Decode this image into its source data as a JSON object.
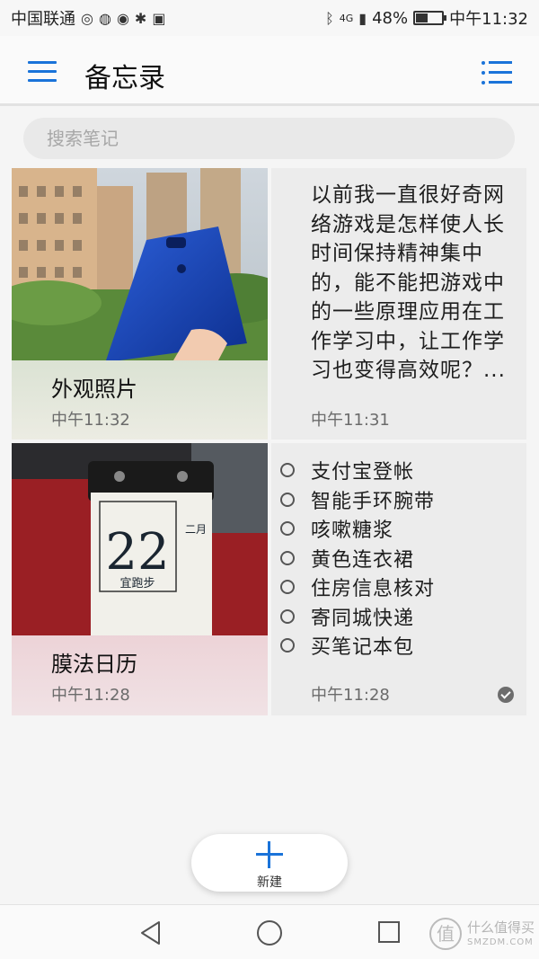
{
  "status_bar": {
    "carrier": "中国联通",
    "battery_percent": "48%",
    "network": "4G",
    "time": "中午11:32",
    "battery_level": 0.48,
    "app_icons": [
      "maps-icon",
      "wechat-icon",
      "weibo-icon",
      "app-icon",
      "shield-icon"
    ]
  },
  "app_bar": {
    "title": "备忘录"
  },
  "search": {
    "placeholder": "搜索笔记"
  },
  "notes": [
    {
      "type": "photo",
      "title": "外观照片",
      "time": "中午11:32"
    },
    {
      "type": "text",
      "text": "以前我一直很好奇网络游戏是怎样使人长时间保持精神集中的，能不能把游戏中的一些原理应用在工作学习中，让工作学习也变得高效呢？...",
      "time": "中午11:31"
    },
    {
      "type": "photo",
      "title": "膜法日历",
      "time": "中午11:28",
      "calendar": {
        "day": "22",
        "month": "二月",
        "note": "宜跑步"
      }
    },
    {
      "type": "checklist",
      "items": [
        "支付宝登帐",
        "智能手环腕带",
        "咳嗽糖浆",
        "黄色连衣裙",
        "住房信息核对",
        "寄同城快递",
        "买笔记本包"
      ],
      "time": "中午11:28"
    }
  ],
  "new_button": {
    "label": "新建"
  },
  "watermark": {
    "logo": "值",
    "text": "什么值得买",
    "sub": "SMZDM.COM"
  },
  "colors": {
    "accent": "#1a73d9",
    "background": "#f5f5f5"
  }
}
